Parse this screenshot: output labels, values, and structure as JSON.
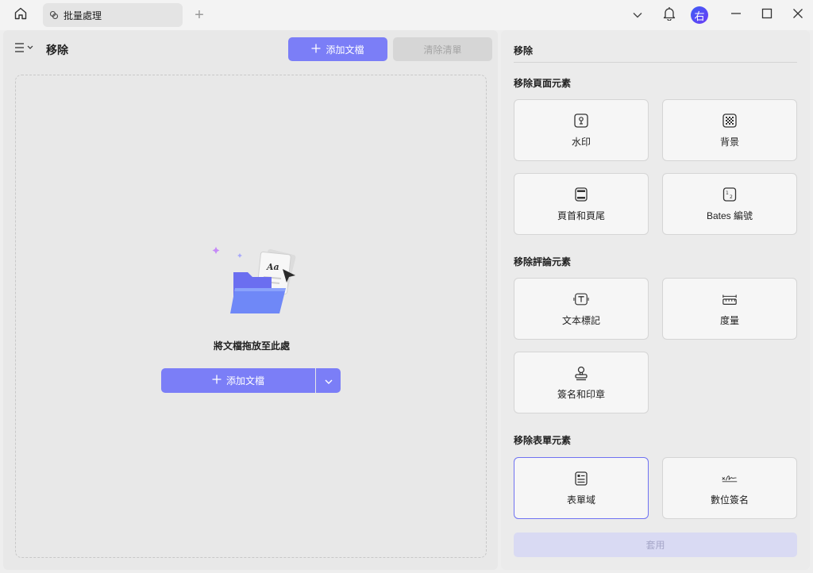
{
  "tab": {
    "label": "批量處理"
  },
  "avatar": {
    "label": "右"
  },
  "left_pane": {
    "title": "移除",
    "add_button": "添加文檔",
    "clear_button": "清除清單",
    "drop_text": "將文檔拖放至此處",
    "drop_add_button": "添加文檔"
  },
  "right_pane": {
    "title": "移除",
    "sections": [
      {
        "title": "移除頁面元素",
        "items": [
          {
            "label": "水印",
            "icon": "watermark-icon"
          },
          {
            "label": "背景",
            "icon": "background-icon"
          },
          {
            "label": "頁首和頁尾",
            "icon": "header-footer-icon"
          },
          {
            "label": "Bates 編號",
            "icon": "bates-number-icon"
          }
        ]
      },
      {
        "title": "移除評論元素",
        "items": [
          {
            "label": "文本標記",
            "icon": "text-markup-icon"
          },
          {
            "label": "度量",
            "icon": "measure-icon"
          },
          {
            "label": "簽名和印章",
            "icon": "stamp-icon"
          }
        ]
      },
      {
        "title": "移除表單元素",
        "items": [
          {
            "label": "表單域",
            "icon": "form-field-icon",
            "selected": true
          },
          {
            "label": "數位簽名",
            "icon": "digital-signature-icon"
          }
        ]
      }
    ],
    "apply_button": "套用"
  },
  "colors": {
    "accent": "#7b7ef7",
    "selected_border": "#6f72f2",
    "apply_disabled_bg": "#d9daf3"
  }
}
